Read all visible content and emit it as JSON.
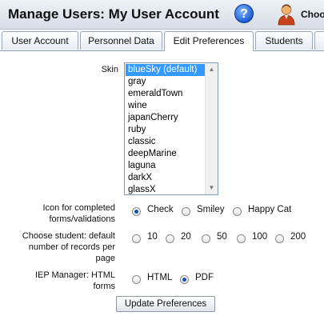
{
  "header": {
    "title": "Manage Users: My User Account",
    "help_label": "?",
    "user_name": "Choo"
  },
  "tabs": [
    {
      "label": "User Account",
      "active": false
    },
    {
      "label": "Personnel Data",
      "active": false
    },
    {
      "label": "Edit Preferences",
      "active": true
    },
    {
      "label": "Students",
      "active": false
    }
  ],
  "skin": {
    "label": "Skin",
    "options": [
      "blueSky (default)",
      "gray",
      "emeraldTown",
      "wine",
      "japanCherry",
      "ruby",
      "classic",
      "deepMarine",
      "laguna",
      "darkX",
      "glassX"
    ],
    "selected": "blueSky (default)"
  },
  "icon_setting": {
    "label": "Icon for completed forms/validations",
    "options": [
      "Check",
      "Smiley",
      "Happy Cat"
    ],
    "selected": "Check"
  },
  "records_setting": {
    "label": "Choose student: default number of records per page",
    "options": [
      "10",
      "20",
      "50",
      "100",
      "200"
    ],
    "selected": null
  },
  "iep_setting": {
    "label": "IEP Manager: HTML forms",
    "options": [
      "HTML",
      "PDF"
    ],
    "selected": "PDF"
  },
  "update_button": {
    "label": "Update Preferences"
  },
  "colors": {
    "accent": "#3399ff",
    "help_button": "#1f5fd6"
  },
  "icons": {
    "help": "help-icon",
    "user": "user-avatar-icon"
  }
}
